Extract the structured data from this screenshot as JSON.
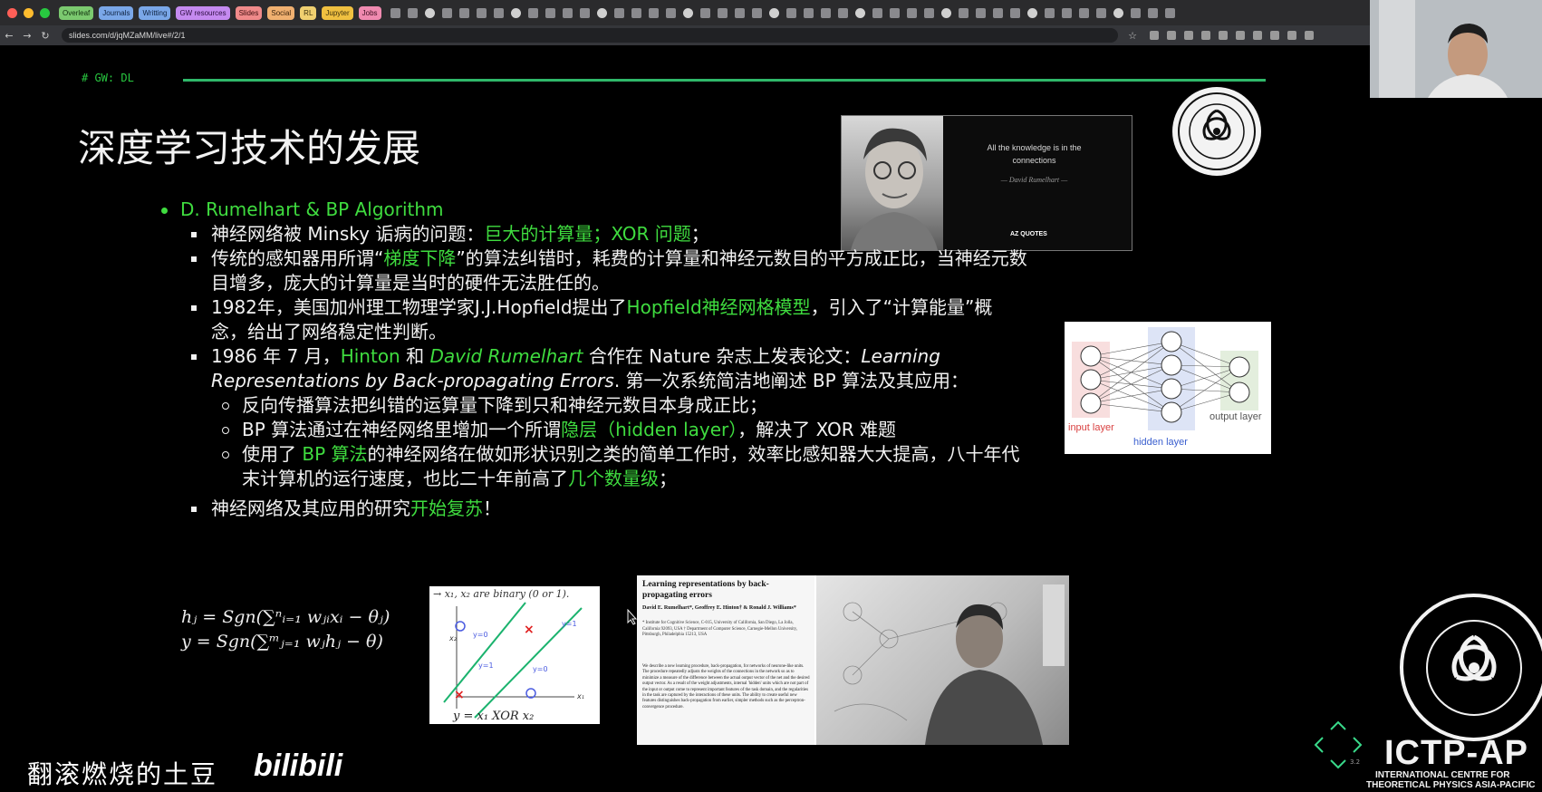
{
  "browser": {
    "tabs": [
      {
        "label": "Overleaf",
        "bg": "#7bc96f",
        "fg": "#10300d"
      },
      {
        "label": "Journals",
        "bg": "#7aa7e8",
        "fg": "#0e2240"
      },
      {
        "label": "Writting",
        "bg": "#7aa7e8",
        "fg": "#0e2240"
      },
      {
        "label": "GW resources",
        "bg": "#c58af0",
        "fg": "#2c0d40"
      },
      {
        "label": "Slides",
        "bg": "#f08a8a",
        "fg": "#3d0d0d"
      },
      {
        "label": "Social",
        "bg": "#f0b070",
        "fg": "#3d240d"
      },
      {
        "label": "RL",
        "bg": "#f0d070",
        "fg": "#3d320d"
      },
      {
        "label": "Jupyter",
        "bg": "#f0c040",
        "fg": "#3d300d"
      },
      {
        "label": "Jobs",
        "bg": "#f08ab0",
        "fg": "#3d0d20"
      }
    ],
    "url": "slides.com/d/jqMZaMM/live#/2/1"
  },
  "slide": {
    "tag": "# GW: DL",
    "title": "深度学习技术的发展",
    "quote": {
      "text": "All the knowledge is in the connections",
      "author": "— David Rumelhart —",
      "brand": "AZ QUOTES"
    },
    "bullets": {
      "heading": "D. Rumelhart & BP Algorithm",
      "b1": {
        "pre": "神经网络被 Minsky 诟病的问题：",
        "hl": "巨大的计算量；XOR 问题",
        "post": "；"
      },
      "b2": {
        "pre": "传统的感知器用所谓“",
        "hl": "梯度下降",
        "post": "”的算法纠错时，耗费的计算量和神经元数目的平方成正比，当神经元数目增多，庞大的计算量是当时的硬件无法胜任的。"
      },
      "b3": {
        "pre": "1982年，美国加州理工物理学家J.J.Hopfield提出了",
        "hl": "Hopfield神经网格模型",
        "post": "，引入了“计算能量”概念，给出了网络稳定性判断。"
      },
      "b4": {
        "pre": "1986 年 7 月，",
        "hl1": "Hinton",
        "mid": " 和 ",
        "hl2": "David Rumelhart",
        "mid2": " 合作在 Nature 杂志上发表论文：",
        "paper": "Learning Representations by Back-propagating Errors",
        "post": ". 第一次系统简洁地阐述 BP 算法及其应用："
      },
      "s1": "反向传播算法把纠错的运算量下降到只和神经元数目本身成正比；",
      "s2": {
        "pre": "BP 算法通过在神经网络里增加一个所谓",
        "hl": "隐层（hidden layer）",
        "post": "，解决了 XOR 难题"
      },
      "s3": {
        "pre": "使用了 ",
        "hl": "BP 算法",
        "mid": "的神经网络在做如形状识别之类的简单工作时，效率比感知器大大提高，八十年代末计算机的运行速度，也比二十年前高了",
        "hl2": "几个数量级",
        "post": "；"
      },
      "b5": {
        "pre": "神经网络及其应用的研究",
        "hl": "开始复苏",
        "post": "！"
      }
    },
    "nn": {
      "input": "input layer",
      "hidden": "hidden layer",
      "output": "output layer"
    },
    "formula": {
      "line1": "hⱼ = Sgn(∑ⁿᵢ₌₁ wⱼᵢxᵢ − θⱼ)",
      "line2": "y = Sgn(∑ᵐⱼ₌₁ wⱼhⱼ − θ)"
    },
    "xor": {
      "note": "→ x₁, x₂ are binary (0 or 1).",
      "caption": "y = x₁ XOR x₂",
      "x1": "x₁",
      "x2": "x₂",
      "y1a": "y=1",
      "y1b": "y=1",
      "y0a": "y=0",
      "y0b": "y=0"
    },
    "paper": {
      "title": "Learning representations by back-propagating errors",
      "authors": "David E. Rumelhart*, Geoffrey E. Hinton† & Ronald J. Williams*",
      "affil": "* Institute for Cognitive Science, C-015, University of California, San Diego, La Jolla, California 92093, USA  † Department of Computer Science, Carnegie-Mellon University, Pittsburgh, Philadelphia 15213, USA",
      "abstract": "We describe a new learning procedure, back-propagation, for networks of neurone-like units. The procedure repeatedly adjusts the weights of the connections in the network so as to minimize a measure of the difference between the actual output vector of the net and the desired output vector. As a result of the weight adjustments, internal 'hidden' units which are not part of the input or output come to represent important features of the task domain, and the regularities in the task are captured by the interactions of these units. The ability to create useful new features distinguishes back-propagation from earlier, simpler methods such as the perceptron-convergence procedure."
    },
    "page": "3.2"
  },
  "branding": {
    "ictp": "ICTP-AP",
    "ictp_sub1": "INTERNATIONAL CENTRE FOR",
    "ictp_sub2": "THEORETICAL PHYSICS ASIA-PACIFIC",
    "watermark": "翻滚燃烧的土豆",
    "bili": "bilibili"
  }
}
